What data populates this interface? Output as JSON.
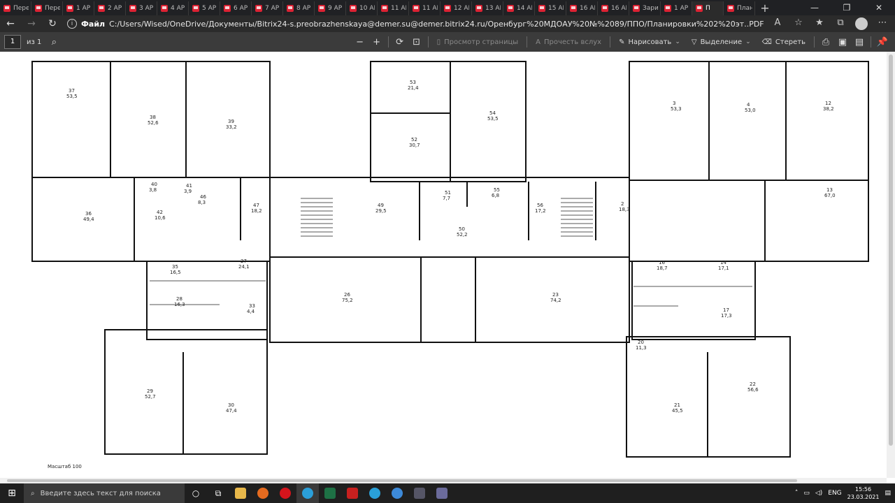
{
  "tabs": [
    {
      "label": "Пере"
    },
    {
      "label": "Пере"
    },
    {
      "label": "1 АР"
    },
    {
      "label": "2 АР"
    },
    {
      "label": "3 АР"
    },
    {
      "label": "4 АР"
    },
    {
      "label": "5 АР"
    },
    {
      "label": "6 АР"
    },
    {
      "label": "7 АР"
    },
    {
      "label": "8 АР"
    },
    {
      "label": "9 АР"
    },
    {
      "label": "10 АР"
    },
    {
      "label": "11 АР"
    },
    {
      "label": "11 АР"
    },
    {
      "label": "12 АР"
    },
    {
      "label": "13 АР"
    },
    {
      "label": "14 АР"
    },
    {
      "label": "15 АР"
    },
    {
      "label": "16 АР"
    },
    {
      "label": "16 АР"
    },
    {
      "label": "Зари"
    },
    {
      "label": "1 АР"
    },
    {
      "label": "П"
    },
    {
      "label": "План"
    }
  ],
  "new_tab": "+",
  "window_controls": {
    "minimize": "—",
    "restore": "❐",
    "close": "✕"
  },
  "address": {
    "back": "←",
    "forward": "→",
    "reload": "↻",
    "scheme": "Файл",
    "url": "C:/Users/Wised/OneDrive/Документы/Bitrix24-s.preobrazhenskaya@demer.su@demer.bitrix24.ru/Оренбург%20МДОАУ%20№%2089/ППО/Планировки%202%20эт..PDF"
  },
  "pdf_toolbar": {
    "page": "1",
    "of": "из 1",
    "view": "Просмотр страницы",
    "read_aloud": "Прочесть вслух",
    "draw": "Нарисовать",
    "highlight": "Выделение",
    "erase": "Стереть"
  },
  "plan": {
    "scale": "Масштаб 100",
    "rooms": [
      {
        "no": "37",
        "area": "53,5"
      },
      {
        "no": "38",
        "area": "52,6"
      },
      {
        "no": "39",
        "area": "33,2"
      },
      {
        "no": "36",
        "area": "49,4"
      },
      {
        "no": "40",
        "area": "3,8"
      },
      {
        "no": "41",
        "area": "3,9"
      },
      {
        "no": "42",
        "area": "10,6"
      },
      {
        "no": "46",
        "area": "8,3"
      },
      {
        "no": "47",
        "area": "18,2"
      },
      {
        "no": "53",
        "area": "21,4"
      },
      {
        "no": "54",
        "area": "53,5"
      },
      {
        "no": "52",
        "area": "30,7"
      },
      {
        "no": "49",
        "area": "29,5"
      },
      {
        "no": "51",
        "area": "7,7"
      },
      {
        "no": "55",
        "area": "6,8"
      },
      {
        "no": "50",
        "area": "52,2"
      },
      {
        "no": "56",
        "area": "17,2"
      },
      {
        "no": "3",
        "area": "53,3"
      },
      {
        "no": "4",
        "area": "53,0"
      },
      {
        "no": "12",
        "area": "38,2"
      },
      {
        "no": "13",
        "area": "67,0"
      },
      {
        "no": "2",
        "area": "18,3"
      },
      {
        "no": "26",
        "area": "75,2"
      },
      {
        "no": "23",
        "area": "74,2"
      },
      {
        "no": "29",
        "area": "52,7"
      },
      {
        "no": "30",
        "area": "47,4"
      },
      {
        "no": "21",
        "area": "45,5"
      },
      {
        "no": "22",
        "area": "56,6"
      },
      {
        "no": "35",
        "area": "16,5"
      },
      {
        "no": "28",
        "area": "16,3"
      },
      {
        "no": "16",
        "area": "18,7"
      },
      {
        "no": "14",
        "area": "17,1"
      },
      {
        "no": "17",
        "area": "17,3"
      },
      {
        "no": "20",
        "area": "11,3"
      },
      {
        "no": "27",
        "area": "24,1"
      },
      {
        "no": "33",
        "area": "4,4"
      }
    ]
  },
  "taskbar": {
    "search_placeholder": "Введите здесь текст для поиска",
    "lang": "ENG",
    "time": "15:56",
    "date": "23.03.2021"
  },
  "colors": {
    "tab_bg": "#202124",
    "toolbar_bg": "#3b3b3b",
    "pdf_icon": "#d23",
    "taskbar": "#1f1f1f"
  },
  "icons": [
    "pdf-icon",
    "search-icon",
    "zoom-out-icon",
    "zoom-in-icon",
    "rotate-icon",
    "fit-page-icon",
    "draw-icon",
    "highlight-icon",
    "eraser-icon",
    "print-icon",
    "save-icon",
    "pin-icon",
    "windows-start-icon"
  ]
}
